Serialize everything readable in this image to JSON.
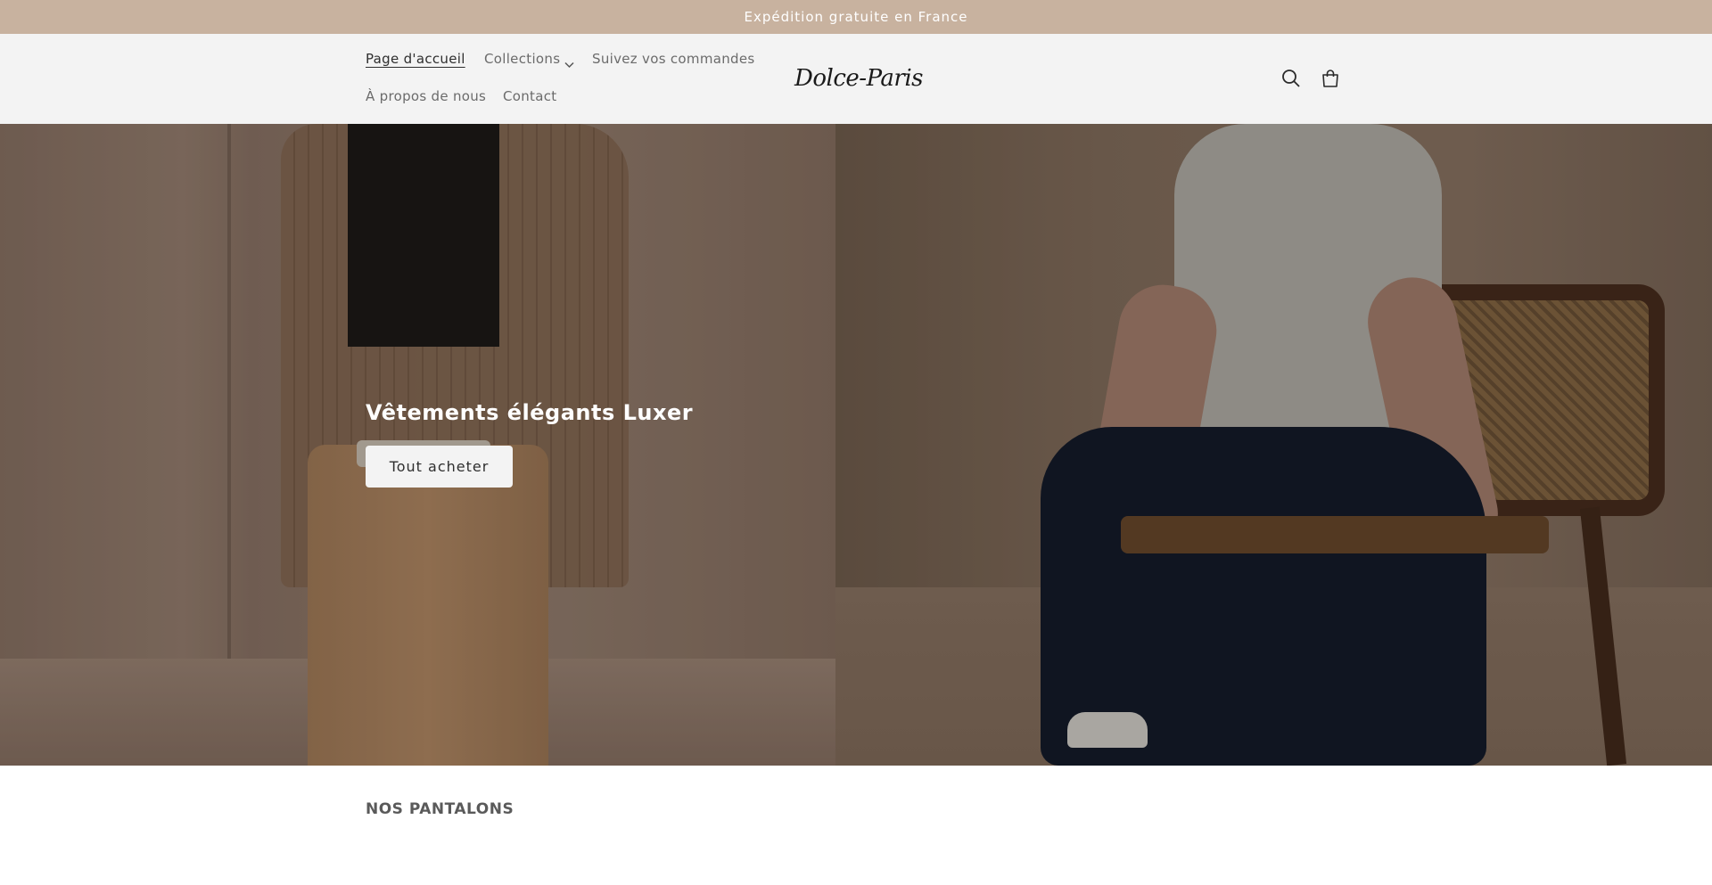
{
  "announcement": {
    "text": "Expédition gratuite en France"
  },
  "header": {
    "nav": [
      {
        "label": "Page d'accueil",
        "active": true
      },
      {
        "label": "Collections",
        "has_dropdown": true
      },
      {
        "label": "Suivez vos commandes"
      },
      {
        "label": "À propos de nous"
      },
      {
        "label": "Contact"
      }
    ],
    "logo": "Dolce-Paris",
    "icons": [
      "search-icon",
      "cart-icon"
    ]
  },
  "hero": {
    "title": "Vêtements élégants Luxer",
    "button_label": "Tout acheter"
  },
  "section": {
    "title": "NOS PANTALONS"
  },
  "colors": {
    "announcement_bg": "#c8b29f",
    "header_bg": "#f3f3f3",
    "button_bg": "#f3f3f3"
  }
}
